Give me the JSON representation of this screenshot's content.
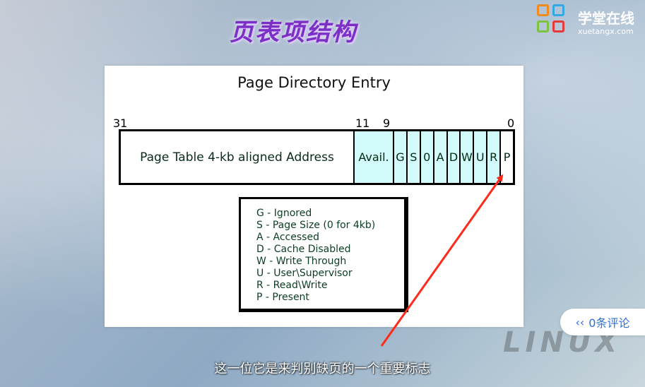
{
  "title": "页表项结构",
  "logo": {
    "name": "学堂在线",
    "url": "xuetangx.com"
  },
  "colors": {
    "title": "#7b2fc4",
    "cell_fill": "#d4fbfb",
    "legend_text": "#0b3d22",
    "arrow": "#ff2a1a",
    "comment": "#2f6fd6"
  },
  "slide": {
    "heading": "Page Directory Entry",
    "bit_numbers": {
      "high": "31",
      "mid1": "11",
      "mid2": "9",
      "low": "0"
    },
    "fields": {
      "address": "Page Table 4-kb aligned Address",
      "avail": "Avail.",
      "flags": [
        "G",
        "S",
        "0",
        "A",
        "D",
        "W",
        "U",
        "R",
        "P"
      ]
    },
    "legend": [
      "G - Ignored",
      "S - Page Size (0 for 4kb)",
      "A - Accessed",
      "D - Cache Disabled",
      "W - Write Through",
      "U - User\\Supervisor",
      "R - Read\\Write",
      "P - Present"
    ]
  },
  "comment_button": {
    "icon": "double-chevron-left-icon",
    "label": "0条评论"
  },
  "watermark": "LINUX",
  "subtitle": "这一位它是来判别缺页的一个重要标志"
}
